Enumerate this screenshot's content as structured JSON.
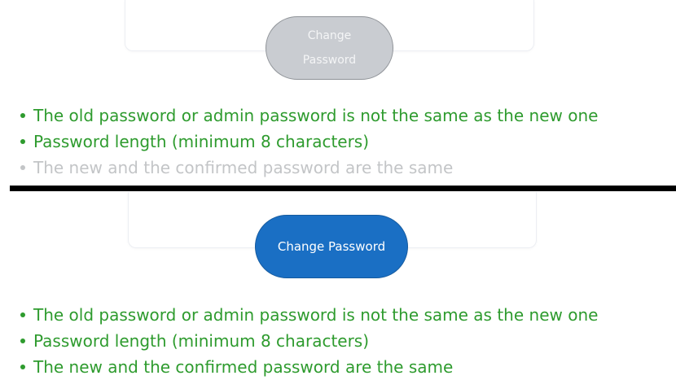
{
  "before": {
    "button_label": "Change Password",
    "button_state": "disabled",
    "rules": [
      {
        "text": "The old password or admin password is not the same as the new one",
        "state": "met"
      },
      {
        "text": "Password length (minimum 8 characters)",
        "state": "met"
      },
      {
        "text": "The new and the confirmed password are the same",
        "state": "unmet"
      }
    ]
  },
  "after": {
    "button_label": "Change Password",
    "button_state": "enabled",
    "rules": [
      {
        "text": "The old password or admin password is not the same as the new one",
        "state": "met"
      },
      {
        "text": "Password length (minimum 8 characters)",
        "state": "met"
      },
      {
        "text": "The new and the confirmed password are the same",
        "state": "met"
      }
    ]
  },
  "colors": {
    "met": "#2e9b2e",
    "unmet": "#c3c5c7",
    "button_enabled": "#1a6fc4",
    "button_disabled": "#c9ccd1"
  }
}
